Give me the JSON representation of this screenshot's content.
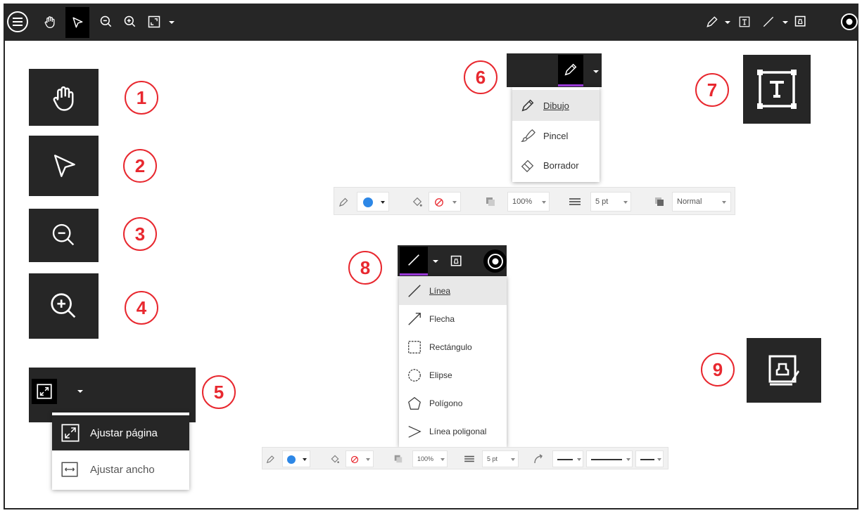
{
  "callouts": [
    "1",
    "2",
    "3",
    "4",
    "5",
    "6",
    "7",
    "8",
    "9"
  ],
  "fit_menu": {
    "items": [
      "Ajustar página",
      "Ajustar ancho"
    ]
  },
  "draw_menu": {
    "items": [
      "Dibujo",
      "Pincel",
      "Borrador"
    ]
  },
  "shape_menu": {
    "items": [
      "Línea",
      "Flecha",
      "Rectángulo",
      "Elipse",
      "Polígono",
      "Línea poligonal"
    ]
  },
  "draw_props": {
    "opacity": "100%",
    "thickness": "5 pt",
    "blend": "Normal",
    "color": "#2d87e6"
  },
  "shape_props": {
    "opacity": "100%",
    "thickness": "5 pt",
    "color": "#2d87e6"
  },
  "colors": {
    "accent_red": "#e8282f",
    "toolbar_dark": "#262626",
    "active_underline": "#a03be0"
  },
  "icons": [
    "menu-icon",
    "hand-icon",
    "select-arrow-icon",
    "zoom-out-icon",
    "zoom-in-icon",
    "fit-page-icon",
    "pen-icon",
    "text-box-icon",
    "line-icon",
    "stamp-icon",
    "stop-icon",
    "brush-icon",
    "eraser-icon",
    "arrow-icon",
    "rectangle-icon",
    "ellipse-icon",
    "polygon-icon",
    "polyline-icon",
    "fill-icon",
    "no-fill-icon",
    "opacity-icon",
    "thickness-icon",
    "blend-icon",
    "line-style-icon"
  ]
}
